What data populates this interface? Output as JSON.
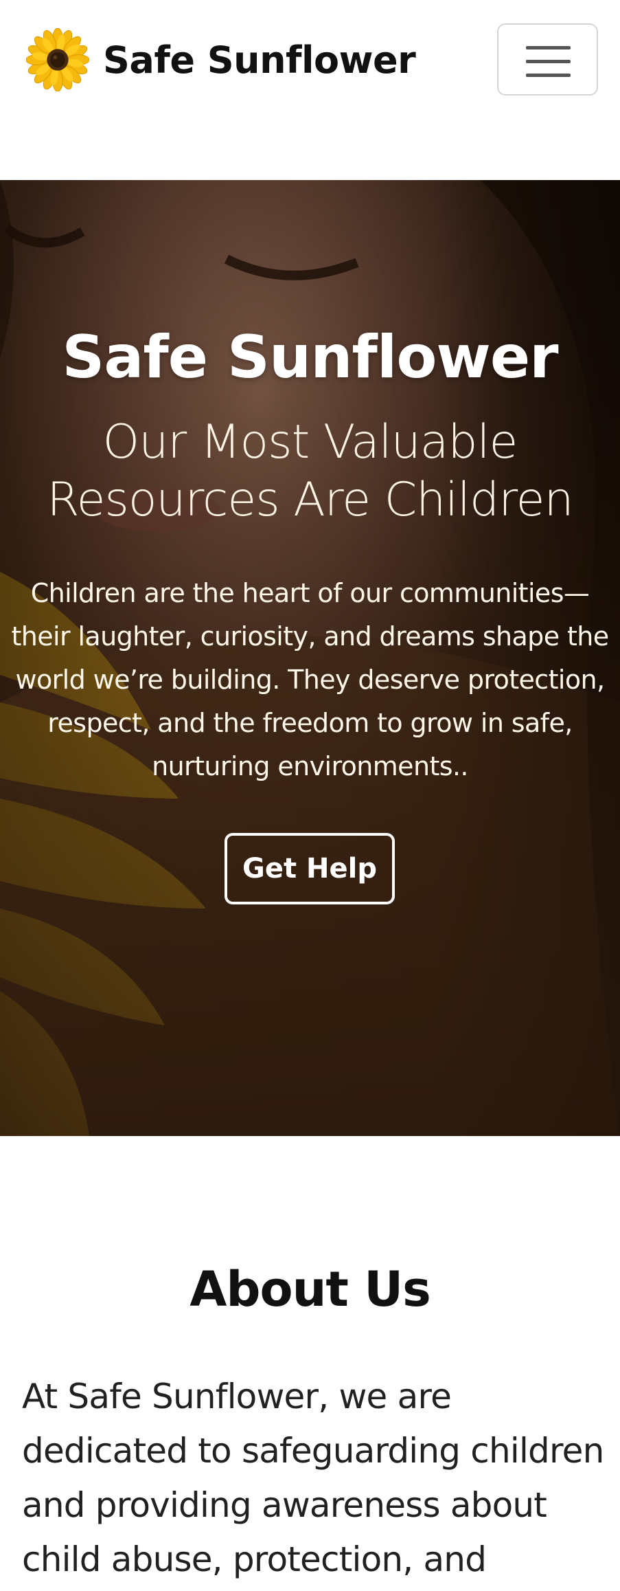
{
  "navbar": {
    "brand_text": "Safe Sunflower",
    "logo_icon": "sunflower-icon",
    "toggler_icon": "hamburger-menu-icon"
  },
  "hero": {
    "title": "Safe Sunflower",
    "subtitle": "Our Most Valuable Resources Are Children",
    "text": "Children are the heart of our communities—their laughter, curiosity, and dreams shape the world we’re building. They deserve protection, respect, and the freedom to grow in safe, nurturing environments..",
    "button_label": "Get Help"
  },
  "about": {
    "title": "About Us",
    "text": "At Safe Sunflower, we are dedicated to safeguarding children and providing awareness about child abuse, protection, and"
  },
  "colors": {
    "brand_yellow": "#f2b705",
    "sunflower_center": "#3a2410",
    "hero_overlay": "#2a1a10",
    "text_dark": "#111111"
  }
}
